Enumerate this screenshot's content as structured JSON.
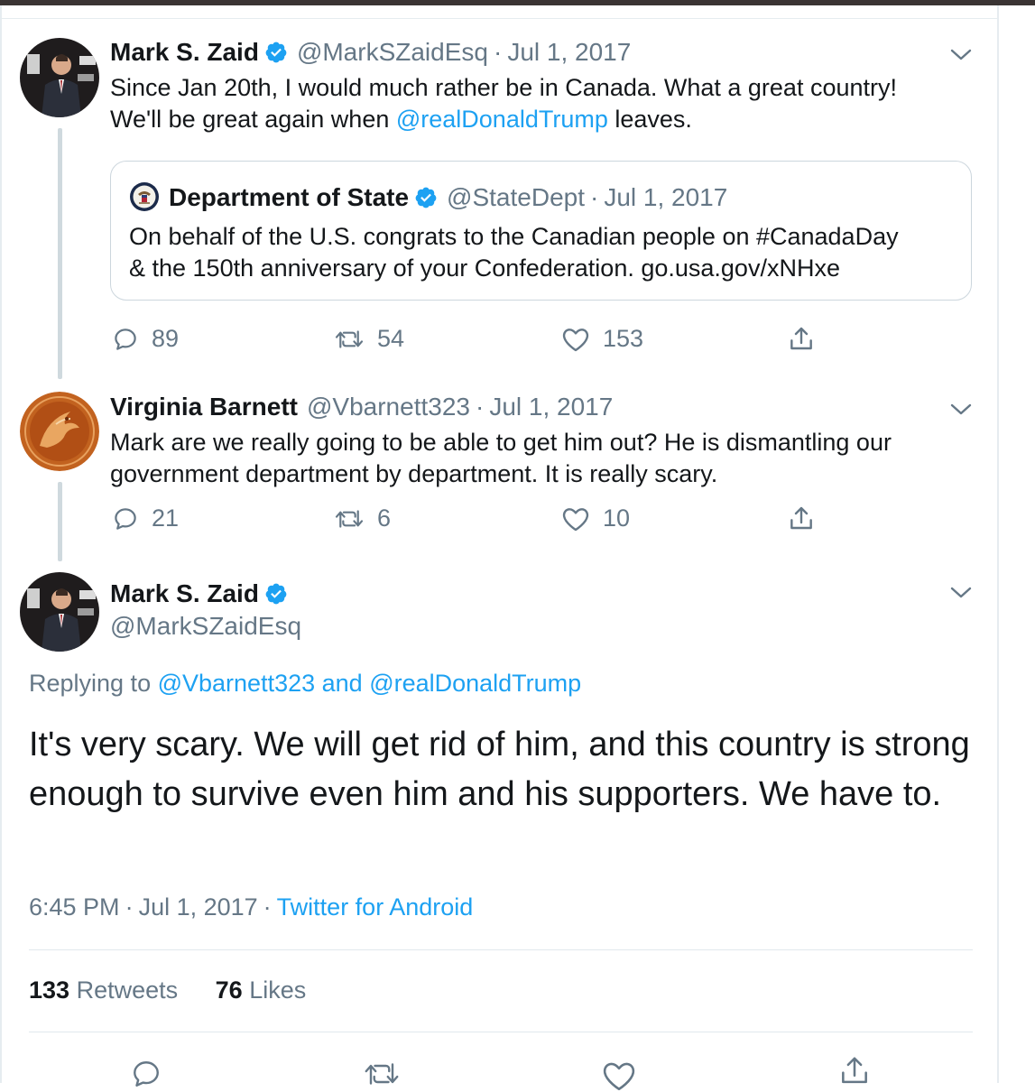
{
  "tweet1": {
    "name": "Mark S. Zaid",
    "handle": "@MarkSZaidEsq",
    "date": "Jul 1, 2017",
    "line1": "Since Jan 20th, I would much rather be in Canada. What a great country!",
    "line2_prefix": "We'll be great again when ",
    "line2_mention": "@realDonaldTrump",
    "line2_suffix": " leaves.",
    "replies": "89",
    "retweets": "54",
    "likes": "153"
  },
  "quote": {
    "name": "Department of State",
    "handle": "@StateDept",
    "date": "Jul 1, 2017",
    "line1": "On behalf of the U.S. congrats to the Canadian people on #CanadaDay",
    "line2": "& the 150th anniversary of your Confederation. go.usa.gov/xNHxe"
  },
  "tweet2": {
    "name": "Virginia Barnett",
    "handle": "@Vbarnett323",
    "date": "Jul 1, 2017",
    "line1": "Mark are we really going to be able to get him out? He is dismantling our",
    "line2": "government department by department. It is really scary.",
    "replies": "21",
    "retweets": "6",
    "likes": "10"
  },
  "main_tweet": {
    "name": "Mark S. Zaid",
    "handle": "@MarkSZaidEsq",
    "replying_label": "Replying to ",
    "replying_mention1": "@Vbarnett323",
    "replying_and": " and ",
    "replying_mention2": "@realDonaldTrump",
    "text": "It's very scary. We will get rid of him, and this country is strong enough to survive even him and his supporters. We have to.",
    "time": "6:45 PM",
    "date": "Jul 1, 2017",
    "source": "Twitter for Android",
    "retweet_count": "133",
    "retweet_label": "Retweets",
    "like_count": "76",
    "like_label": "Likes"
  },
  "separator": "·",
  "colors": {
    "link": "#1da1f2",
    "muted": "#657786",
    "text": "#14171a",
    "verified": "#1da1f2"
  },
  "icons": [
    "reply-icon",
    "retweet-icon",
    "like-icon",
    "share-icon",
    "chevron-down-icon",
    "verified-badge-icon"
  ]
}
